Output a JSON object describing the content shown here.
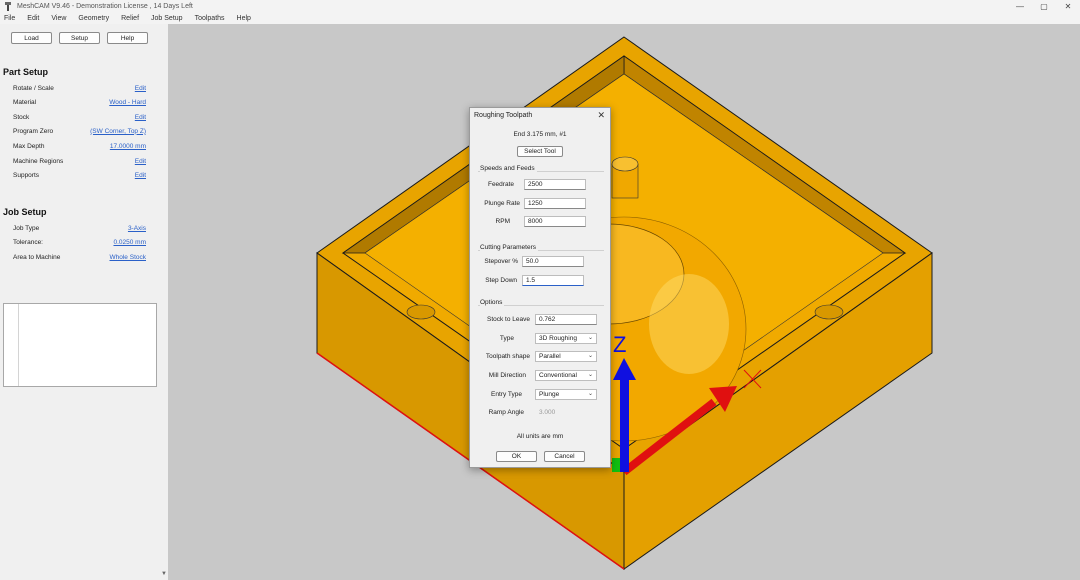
{
  "window": {
    "title": "MeshCAM V9.46 - Demonstration License , 14 Days Left",
    "controls": {
      "minimize": "—",
      "maximize": "▢",
      "close": "✕"
    }
  },
  "menu": [
    "File",
    "Edit",
    "View",
    "Geometry",
    "Relief",
    "Job Setup",
    "Toolpaths",
    "Help"
  ],
  "left_panel": {
    "buttons": {
      "load": "Load",
      "setup": "Setup",
      "help": "Help"
    },
    "part_setup": {
      "title": "Part Setup",
      "rows": [
        {
          "label": "Rotate / Scale",
          "value": "Edit"
        },
        {
          "label": "Material",
          "value": "Wood - Hard"
        },
        {
          "label": "Stock",
          "value": "Edit"
        },
        {
          "label": "Program Zero",
          "value": "(SW Corner, Top Z)"
        },
        {
          "label": "Max Depth",
          "value": "17.0000 mm"
        },
        {
          "label": "Machine Regions",
          "value": "Edit"
        },
        {
          "label": "Supports",
          "value": "Edit"
        }
      ]
    },
    "job_setup": {
      "title": "Job Setup",
      "rows": [
        {
          "label": "Job Type",
          "value": "3-Axis"
        },
        {
          "label": "Tolerance:",
          "value": "0.0250 mm"
        },
        {
          "label": "Area to Machine",
          "value": "Whole Stock"
        }
      ]
    }
  },
  "dialog": {
    "title": "Roughing Toolpath",
    "close": "✕",
    "tool": "End 3.175 mm, #1",
    "select_tool": "Select Tool",
    "speeds": {
      "title": "Speeds and Feeds",
      "feedrate_label": "Feedrate",
      "feedrate": "2500",
      "plunge_label": "Plunge Rate",
      "plunge": "1250",
      "rpm_label": "RPM",
      "rpm": "8000"
    },
    "cutting": {
      "title": "Cutting Parameters",
      "stepover_label": "Stepover %",
      "stepover": "50.0",
      "stepdown_label": "Step Down",
      "stepdown": "1.5"
    },
    "options": {
      "title": "Options",
      "stock_label": "Stock to Leave",
      "stock": "0.762",
      "type_label": "Type",
      "type": "3D Roughing",
      "shape_label": "Toolpath shape",
      "shape": "Parallel",
      "direction_label": "Mill Direction",
      "direction": "Conventional",
      "entry_label": "Entry Type",
      "entry": "Plunge",
      "ramp_label": "Ramp Angle",
      "ramp": "3.000"
    },
    "units_note": "All units are mm",
    "ok": "OK",
    "cancel": "Cancel"
  },
  "viewport": {
    "axis_label": "Z",
    "colors": {
      "background": "#c8c8c8",
      "part": "#f0a800",
      "part_dark": "#c88800",
      "axis_z": "#1010e0",
      "axis_x": "#e01010",
      "axis_y": "#10c010"
    }
  }
}
